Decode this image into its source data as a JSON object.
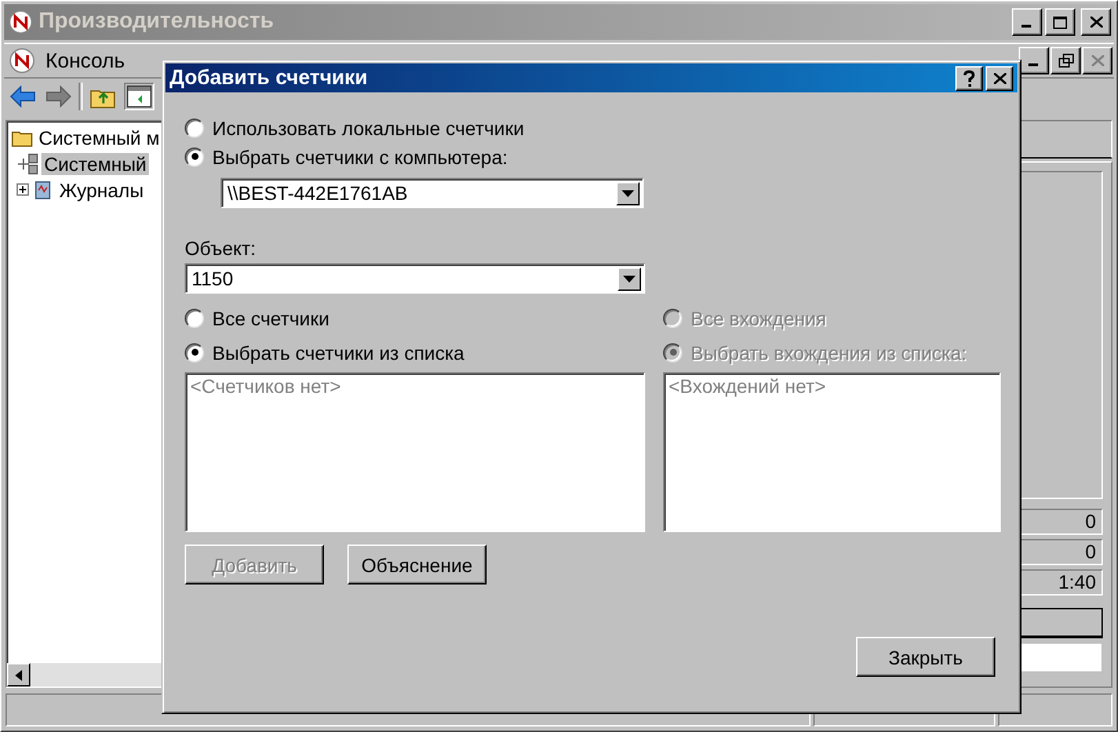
{
  "window": {
    "title": "Производительность",
    "active": false
  },
  "menu": [
    {
      "label": "Консоль"
    }
  ],
  "tree": [
    {
      "label": "Системный м",
      "selected": false,
      "children": [
        {
          "label": "Системный",
          "selected": true
        },
        {
          "label": "Журналы",
          "selected": false,
          "expanded": false
        }
      ]
    }
  ],
  "right_panel": {
    "values": [
      "0",
      "0",
      "1:40"
    ]
  },
  "dialog": {
    "title": "Добавить счетчики",
    "source_options": [
      {
        "label": "Использовать локальные счетчики",
        "selected": false
      },
      {
        "label": "Выбрать счетчики с компьютера:",
        "selected": true
      }
    ],
    "computer": {
      "value": "\\\\BEST-442E1761AB"
    },
    "object": {
      "label": "Объект:",
      "value": "1150"
    },
    "counter_options": [
      {
        "label": "Все счетчики",
        "selected": false,
        "disabled": false
      },
      {
        "label": "Выбрать счетчики из списка",
        "selected": true,
        "disabled": false
      }
    ],
    "counters_list": {
      "empty_text": "<Счетчиков нет>"
    },
    "instance_options": [
      {
        "label": "Все вхождения",
        "selected": false,
        "disabled": true
      },
      {
        "label": "Выбрать вхождения из списка:",
        "selected": true,
        "disabled": true
      }
    ],
    "instances_list": {
      "empty_text": "<Вхождений нет>"
    },
    "buttons": [
      {
        "label": "Добавить",
        "disabled": true
      },
      {
        "label": "Объяснение",
        "disabled": false
      }
    ],
    "close_button": {
      "label": "Закрыть"
    }
  }
}
